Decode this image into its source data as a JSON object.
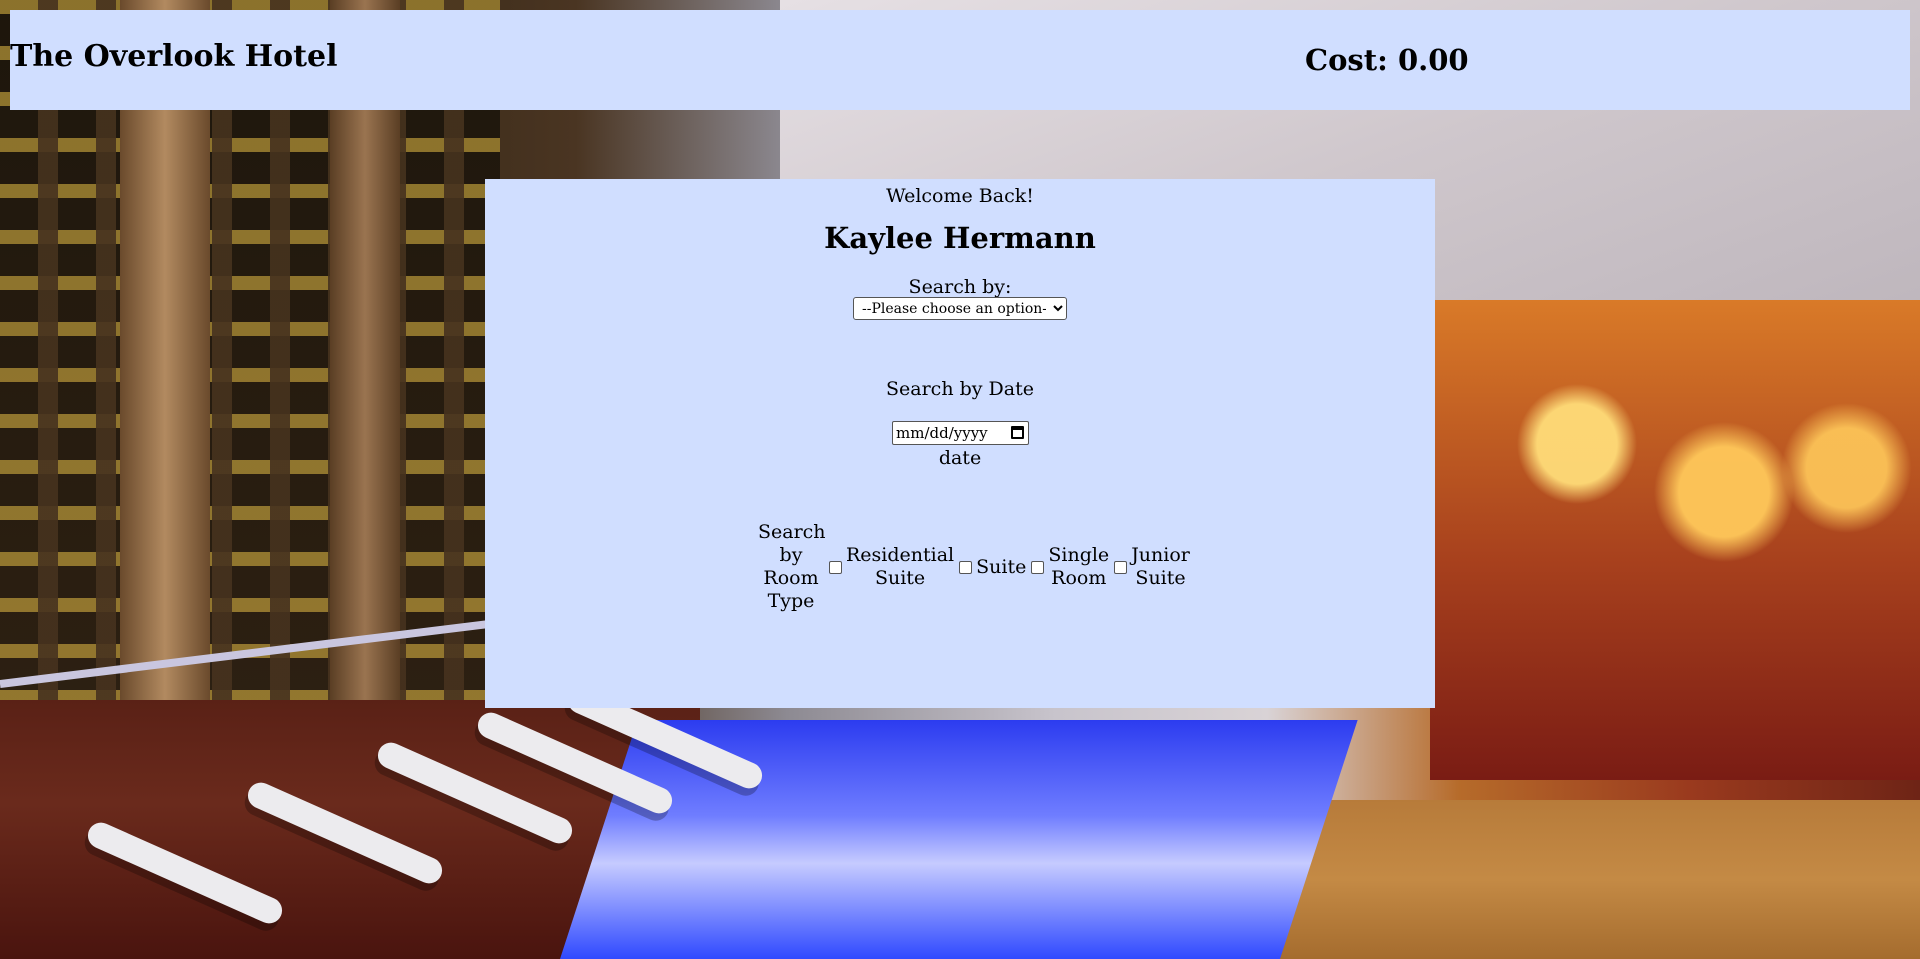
{
  "header": {
    "title": "The Overlook Hotel",
    "cost": "Cost: 0.00"
  },
  "panel": {
    "welcome": "Welcome Back!",
    "user_name": "Kaylee Hermann",
    "search_by_label": "Search by:",
    "search_by_selected": "--Please choose an option--",
    "date_heading": "Search by Date",
    "date_placeholder": "mm/dd/yyyy",
    "date_label": "date",
    "room_type_heading_lines": [
      "Search",
      "by",
      "Room",
      "Type"
    ],
    "room_types": [
      {
        "lines": [
          "Residential",
          "Suite"
        ],
        "checked": false
      },
      {
        "lines": [
          "Suite"
        ],
        "checked": false
      },
      {
        "lines": [
          "Single",
          "Room"
        ],
        "checked": false
      },
      {
        "lines": [
          "Junior",
          "Suite"
        ],
        "checked": false
      }
    ]
  }
}
